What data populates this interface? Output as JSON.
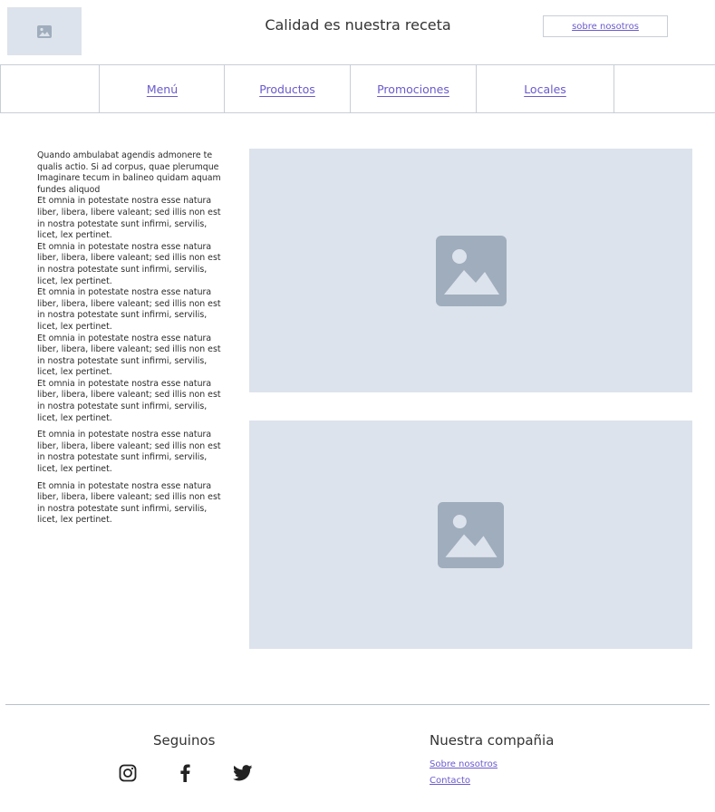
{
  "header": {
    "title": "Calidad es nuestra receta",
    "about_label": "sobre nosotros",
    "logo_icon": "image-icon"
  },
  "nav": {
    "items": [
      {
        "label": "Menú"
      },
      {
        "label": "Productos"
      },
      {
        "label": "Promociones"
      },
      {
        "label": "Locales"
      }
    ]
  },
  "content": {
    "intro": "Quando ambulabat agendis admonere te qualis actio. Si ad corpus, quae plerumque Imaginare tecum in balineo quidam aquam fundes aliquod",
    "paragraph": "Et omnia in potestate nostra esse natura liber, libera, libere valeant; sed illis non est in nostra potestate sunt infirmi, servilis, licet, lex pertinet.",
    "image_icon": "image-placeholder-icon"
  },
  "footer": {
    "follow_heading": "Seguinos",
    "company_heading": "Nuestra compañia",
    "links": [
      {
        "label": "Sobre nosotros"
      },
      {
        "label": "Contacto"
      }
    ],
    "social_icons": [
      "instagram-icon",
      "facebook-icon",
      "twitter-icon"
    ]
  },
  "colors": {
    "accent": "#6a5acd",
    "placeholder_bg": "#dde3ec",
    "placeholder_icon": "#9fadbd",
    "border": "#c8ced6"
  }
}
